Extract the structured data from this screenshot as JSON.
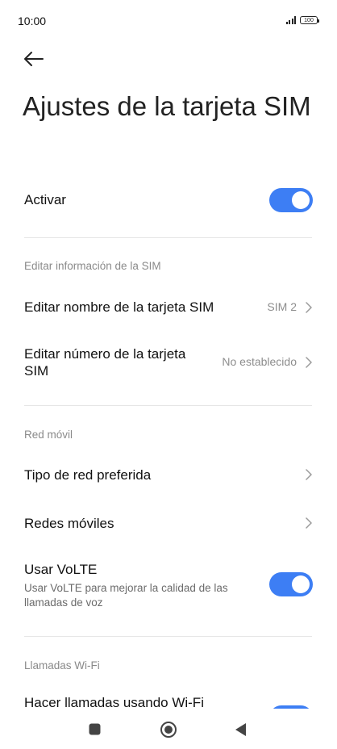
{
  "status_bar": {
    "time": "10:00",
    "battery": "100"
  },
  "page": {
    "title": "Ajustes de la tarjeta SIM"
  },
  "activate": {
    "label": "Activar",
    "enabled": true
  },
  "sections": {
    "sim_info": {
      "header": "Editar información de la SIM",
      "items": [
        {
          "label": "Editar nombre de la tarjeta SIM",
          "value": "SIM 2"
        },
        {
          "label": "Editar número de la tarjeta SIM",
          "value": "No establecido"
        }
      ]
    },
    "mobile_network": {
      "header": "Red móvil",
      "items": [
        {
          "label": "Tipo de red preferida"
        },
        {
          "label": "Redes móviles"
        }
      ],
      "volte": {
        "label": "Usar VoLTE",
        "description": "Usar VoLTE para mejorar la calidad de las llamadas de voz",
        "enabled": true
      }
    },
    "wifi_calls": {
      "header": "Llamadas Wi-Fi",
      "item": {
        "label": "Hacer llamadas usando Wi-Fi",
        "enabled": true
      }
    }
  },
  "nav_bar": {
    "buttons": [
      "recents-icon",
      "home-icon",
      "back-icon"
    ]
  },
  "colors": {
    "accent": "#3d7ef4",
    "divider": "#e6e6e6",
    "secondary_text": "#8d8d8d"
  }
}
